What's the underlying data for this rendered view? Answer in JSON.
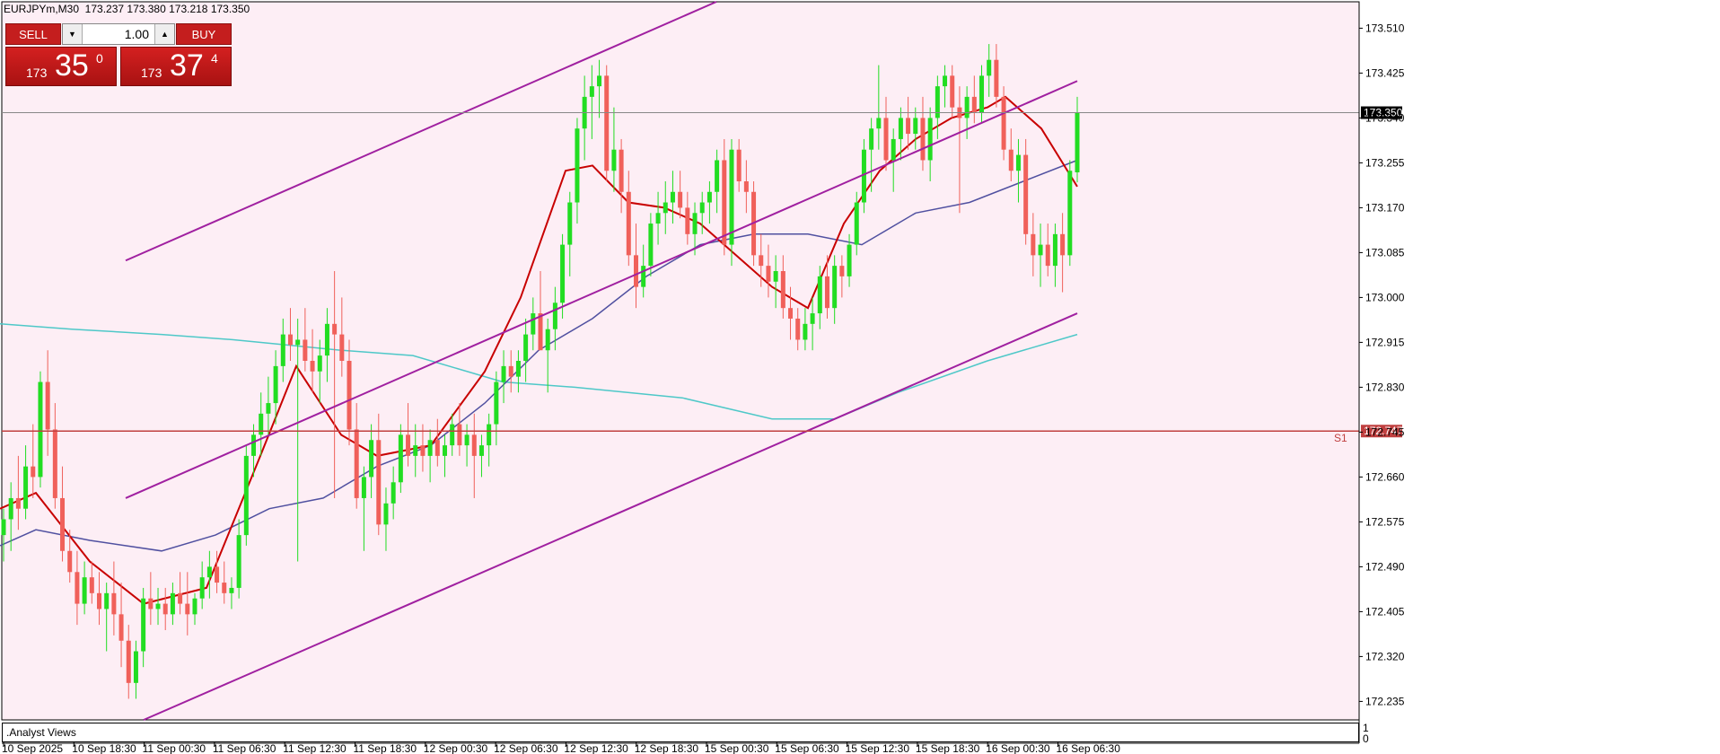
{
  "symbol_info": "EURJPYm,M30  173.237 173.380 173.218 173.350",
  "trade_panel": {
    "sell_label": "SELL",
    "buy_label": "BUY",
    "lot": "1.00",
    "sell_price": {
      "prefix": "173",
      "big": "35",
      "sup": "0"
    },
    "buy_price": {
      "prefix": "173",
      "big": "37",
      "sup": "4"
    }
  },
  "price_axis": {
    "ticks": [
      "173.510",
      "173.425",
      "173.340",
      "173.255",
      "173.170",
      "173.085",
      "173.000",
      "172.915",
      "172.830",
      "172.745",
      "172.660",
      "172.575",
      "172.490",
      "172.405",
      "172.320",
      "172.235"
    ],
    "current_price": "173.350",
    "support_price": "172.747",
    "support_label": "S1"
  },
  "time_axis": {
    "labels": [
      "10 Sep 2025",
      "10 Sep 18:30",
      "11 Sep 00:30",
      "11 Sep 06:30",
      "11 Sep 12:30",
      "11 Sep 18:30",
      "12 Sep 00:30",
      "12 Sep 06:30",
      "12 Sep 12:30",
      "12 Sep 18:30",
      "15 Sep 00:30",
      "15 Sep 06:30",
      "15 Sep 12:30",
      "15 Sep 18:30",
      "16 Sep 00:30",
      "16 Sep 06:30"
    ]
  },
  "indicator_pane": {
    "label": ".Analyst Views",
    "scale_top": "1",
    "scale_bottom": "0"
  },
  "colors": {
    "background": "#fdeef5",
    "bull": "#22dd22",
    "bear": "#f0605a",
    "channel": "#a020a0",
    "ma_fast": "#c80000",
    "ma_mid": "#5050a0",
    "ma_slow": "#4ec8c8",
    "support": "#c04040"
  },
  "chart_data": {
    "type": "candlestick",
    "title": "EURJPYm,M30",
    "ylim": [
      172.2,
      173.56
    ],
    "last": {
      "open": 173.237,
      "high": 173.38,
      "low": 173.218,
      "close": 173.35
    },
    "support_level": 172.747,
    "candles": [
      [
        172.55,
        172.6,
        172.5,
        172.58
      ],
      [
        172.58,
        172.65,
        172.52,
        172.62
      ],
      [
        172.62,
        172.7,
        172.56,
        172.6
      ],
      [
        172.6,
        172.72,
        172.58,
        172.68
      ],
      [
        172.68,
        172.76,
        172.62,
        172.66
      ],
      [
        172.66,
        172.86,
        172.64,
        172.84
      ],
      [
        172.84,
        172.9,
        172.7,
        172.75
      ],
      [
        172.75,
        172.8,
        172.6,
        172.62
      ],
      [
        172.62,
        172.68,
        172.5,
        172.52
      ],
      [
        172.52,
        172.56,
        172.46,
        172.48
      ],
      [
        172.48,
        172.52,
        172.38,
        172.42
      ],
      [
        172.42,
        172.5,
        172.4,
        172.47
      ],
      [
        172.47,
        172.5,
        172.42,
        172.44
      ],
      [
        172.44,
        172.48,
        172.38,
        172.41
      ],
      [
        172.41,
        172.46,
        172.33,
        172.44
      ],
      [
        172.44,
        172.5,
        172.36,
        172.4
      ],
      [
        172.4,
        172.46,
        172.3,
        172.35
      ],
      [
        172.35,
        172.38,
        172.24,
        172.27
      ],
      [
        172.27,
        172.35,
        172.24,
        172.33
      ],
      [
        172.33,
        172.45,
        172.3,
        172.43
      ],
      [
        172.43,
        172.48,
        172.38,
        172.41
      ],
      [
        172.41,
        172.45,
        172.38,
        172.42
      ],
      [
        172.42,
        172.45,
        172.37,
        172.4
      ],
      [
        172.4,
        172.46,
        172.38,
        172.44
      ],
      [
        172.44,
        172.48,
        172.4,
        172.42
      ],
      [
        172.42,
        172.48,
        172.36,
        172.4
      ],
      [
        172.4,
        172.44,
        172.38,
        172.43
      ],
      [
        172.43,
        172.5,
        172.41,
        172.47
      ],
      [
        172.47,
        172.52,
        172.43,
        172.49
      ],
      [
        172.49,
        172.52,
        172.44,
        172.46
      ],
      [
        172.46,
        172.5,
        172.42,
        172.44
      ],
      [
        172.44,
        172.47,
        172.41,
        172.45
      ],
      [
        172.45,
        172.58,
        172.43,
        172.55
      ],
      [
        172.55,
        172.72,
        172.53,
        172.7
      ],
      [
        172.7,
        172.76,
        172.66,
        172.74
      ],
      [
        172.74,
        172.82,
        172.7,
        172.78
      ],
      [
        172.78,
        172.85,
        172.74,
        172.8
      ],
      [
        172.8,
        172.9,
        172.76,
        172.87
      ],
      [
        172.87,
        172.96,
        172.84,
        172.93
      ],
      [
        172.93,
        172.98,
        172.88,
        172.91
      ],
      [
        172.91,
        172.96,
        172.5,
        172.92
      ],
      [
        172.92,
        172.98,
        172.86,
        172.88
      ],
      [
        172.88,
        172.94,
        172.82,
        172.86
      ],
      [
        172.86,
        172.92,
        172.8,
        172.89
      ],
      [
        172.89,
        172.98,
        172.84,
        172.95
      ],
      [
        172.95,
        173.05,
        172.62,
        172.93
      ],
      [
        172.93,
        173.0,
        172.85,
        172.88
      ],
      [
        172.88,
        172.92,
        172.72,
        172.75
      ],
      [
        172.75,
        172.8,
        172.6,
        172.62
      ],
      [
        172.62,
        172.68,
        172.52,
        172.66
      ],
      [
        172.66,
        172.76,
        172.62,
        172.73
      ],
      [
        172.73,
        172.78,
        172.55,
        172.57
      ],
      [
        172.57,
        172.64,
        172.52,
        172.61
      ],
      [
        172.61,
        172.68,
        172.58,
        172.65
      ],
      [
        172.65,
        172.76,
        172.63,
        172.74
      ],
      [
        172.74,
        172.8,
        172.68,
        172.7
      ],
      [
        172.7,
        172.76,
        172.66,
        172.72
      ],
      [
        172.72,
        172.76,
        172.67,
        172.7
      ],
      [
        172.7,
        172.75,
        172.65,
        172.73
      ],
      [
        172.73,
        172.77,
        172.68,
        172.7
      ],
      [
        172.7,
        172.74,
        172.66,
        172.72
      ],
      [
        172.72,
        172.78,
        172.7,
        172.76
      ],
      [
        172.76,
        172.8,
        172.7,
        172.72
      ],
      [
        172.72,
        172.76,
        172.68,
        172.74
      ],
      [
        172.74,
        172.78,
        172.62,
        172.7
      ],
      [
        172.7,
        172.74,
        172.66,
        172.72
      ],
      [
        172.72,
        172.78,
        172.68,
        172.76
      ],
      [
        172.76,
        172.86,
        172.72,
        172.84
      ],
      [
        172.84,
        172.9,
        172.8,
        172.87
      ],
      [
        172.87,
        172.9,
        172.82,
        172.85
      ],
      [
        172.85,
        172.9,
        172.82,
        172.88
      ],
      [
        172.88,
        172.96,
        172.84,
        172.93
      ],
      [
        172.93,
        173.0,
        172.9,
        172.97
      ],
      [
        172.97,
        173.05,
        172.92,
        172.9
      ],
      [
        172.9,
        172.96,
        172.82,
        172.94
      ],
      [
        172.94,
        173.02,
        172.9,
        172.99
      ],
      [
        172.99,
        173.12,
        172.96,
        173.1
      ],
      [
        173.1,
        173.2,
        173.04,
        173.18
      ],
      [
        173.18,
        173.34,
        173.14,
        173.32
      ],
      [
        173.32,
        173.42,
        173.26,
        173.38
      ],
      [
        173.38,
        173.44,
        173.3,
        173.4
      ],
      [
        173.4,
        173.45,
        173.34,
        173.42
      ],
      [
        173.42,
        173.44,
        173.22,
        173.24
      ],
      [
        173.24,
        173.36,
        173.2,
        173.28
      ],
      [
        173.28,
        173.3,
        173.16,
        173.2
      ],
      [
        173.2,
        173.24,
        173.06,
        173.08
      ],
      [
        173.08,
        173.14,
        172.98,
        173.02
      ],
      [
        173.02,
        173.1,
        173.0,
        173.06
      ],
      [
        173.06,
        173.16,
        173.04,
        173.14
      ],
      [
        173.14,
        173.2,
        173.1,
        173.16
      ],
      [
        173.16,
        173.22,
        173.12,
        173.18
      ],
      [
        173.18,
        173.24,
        173.14,
        173.2
      ],
      [
        173.2,
        173.24,
        173.15,
        173.17
      ],
      [
        173.17,
        173.2,
        173.1,
        173.12
      ],
      [
        173.12,
        173.18,
        173.08,
        173.16
      ],
      [
        173.16,
        173.2,
        173.12,
        173.18
      ],
      [
        173.18,
        173.22,
        173.14,
        173.2
      ],
      [
        173.2,
        173.28,
        173.16,
        173.26
      ],
      [
        173.26,
        173.3,
        173.08,
        173.1
      ],
      [
        173.1,
        173.3,
        173.06,
        173.28
      ],
      [
        173.28,
        173.3,
        173.2,
        173.22
      ],
      [
        173.22,
        173.26,
        173.16,
        173.2
      ],
      [
        173.2,
        173.22,
        173.06,
        173.08
      ],
      [
        173.08,
        173.12,
        173.02,
        173.06
      ],
      [
        173.06,
        173.1,
        173.0,
        173.03
      ],
      [
        173.03,
        173.08,
        172.98,
        173.05
      ],
      [
        173.05,
        173.08,
        172.96,
        172.98
      ],
      [
        172.98,
        173.02,
        172.92,
        172.96
      ],
      [
        172.96,
        172.98,
        172.9,
        172.92
      ],
      [
        172.92,
        172.98,
        172.9,
        172.95
      ],
      [
        172.95,
        173.0,
        172.9,
        172.97
      ],
      [
        172.97,
        173.06,
        172.94,
        173.04
      ],
      [
        173.04,
        173.08,
        172.96,
        172.98
      ],
      [
        172.98,
        173.08,
        172.95,
        173.06
      ],
      [
        173.06,
        173.08,
        173.0,
        173.04
      ],
      [
        173.04,
        173.12,
        173.02,
        173.1
      ],
      [
        173.1,
        173.2,
        173.08,
        173.18
      ],
      [
        173.18,
        173.3,
        173.16,
        173.28
      ],
      [
        173.28,
        173.34,
        173.2,
        173.32
      ],
      [
        173.32,
        173.44,
        173.28,
        173.34
      ],
      [
        173.34,
        173.38,
        173.24,
        173.26
      ],
      [
        173.26,
        173.32,
        173.2,
        173.3
      ],
      [
        173.3,
        173.36,
        173.26,
        173.34
      ],
      [
        173.34,
        173.38,
        173.28,
        173.31
      ],
      [
        173.31,
        173.36,
        173.28,
        173.34
      ],
      [
        173.34,
        173.38,
        173.24,
        173.26
      ],
      [
        173.26,
        173.36,
        173.22,
        173.34
      ],
      [
        173.34,
        173.42,
        173.3,
        173.4
      ],
      [
        173.4,
        173.44,
        173.36,
        173.42
      ],
      [
        173.42,
        173.44,
        173.34,
        173.36
      ],
      [
        173.36,
        173.4,
        173.16,
        173.34
      ],
      [
        173.34,
        173.4,
        173.3,
        173.38
      ],
      [
        173.38,
        173.42,
        173.33,
        173.35
      ],
      [
        173.35,
        173.44,
        173.33,
        173.42
      ],
      [
        173.42,
        173.48,
        173.38,
        173.45
      ],
      [
        173.45,
        173.48,
        173.36,
        173.38
      ],
      [
        173.38,
        173.4,
        173.26,
        173.28
      ],
      [
        173.28,
        173.32,
        173.22,
        173.24
      ],
      [
        173.24,
        173.3,
        173.18,
        173.27
      ],
      [
        173.27,
        173.3,
        173.1,
        173.12
      ],
      [
        173.12,
        173.16,
        173.04,
        173.08
      ],
      [
        173.08,
        173.14,
        173.02,
        173.1
      ],
      [
        173.1,
        173.14,
        173.04,
        173.06
      ],
      [
        173.06,
        173.14,
        173.02,
        173.12
      ],
      [
        173.12,
        173.16,
        173.01,
        173.08
      ],
      [
        173.08,
        173.26,
        173.06,
        173.24
      ],
      [
        173.237,
        173.38,
        173.218,
        173.35
      ]
    ],
    "ma_fast": [
      [
        0,
        172.6
      ],
      [
        40,
        172.63
      ],
      [
        100,
        172.5
      ],
      [
        160,
        172.42
      ],
      [
        230,
        172.45
      ],
      [
        290,
        172.7
      ],
      [
        330,
        172.87
      ],
      [
        380,
        172.74
      ],
      [
        420,
        172.7
      ],
      [
        480,
        172.72
      ],
      [
        540,
        172.86
      ],
      [
        580,
        173.0
      ],
      [
        630,
        173.24
      ],
      [
        660,
        173.25
      ],
      [
        700,
        173.18
      ],
      [
        740,
        173.17
      ],
      [
        780,
        173.14
      ],
      [
        820,
        173.08
      ],
      [
        860,
        173.02
      ],
      [
        900,
        172.98
      ],
      [
        940,
        173.14
      ],
      [
        980,
        173.24
      ],
      [
        1020,
        173.3
      ],
      [
        1060,
        173.34
      ],
      [
        1100,
        173.36
      ],
      [
        1120,
        173.38
      ],
      [
        1160,
        173.32
      ],
      [
        1200,
        173.21
      ]
    ],
    "ma_mid": [
      [
        0,
        172.53
      ],
      [
        40,
        172.56
      ],
      [
        100,
        172.54
      ],
      [
        180,
        172.52
      ],
      [
        240,
        172.55
      ],
      [
        300,
        172.6
      ],
      [
        360,
        172.62
      ],
      [
        420,
        172.68
      ],
      [
        480,
        172.72
      ],
      [
        540,
        172.8
      ],
      [
        600,
        172.9
      ],
      [
        660,
        172.96
      ],
      [
        720,
        173.04
      ],
      [
        780,
        173.1
      ],
      [
        840,
        173.12
      ],
      [
        900,
        173.12
      ],
      [
        960,
        173.1
      ],
      [
        1020,
        173.16
      ],
      [
        1080,
        173.18
      ],
      [
        1140,
        173.22
      ],
      [
        1200,
        173.26
      ]
    ],
    "ma_slow": [
      [
        0,
        172.95
      ],
      [
        80,
        172.94
      ],
      [
        180,
        172.93
      ],
      [
        260,
        172.92
      ],
      [
        380,
        172.9
      ],
      [
        460,
        172.89
      ],
      [
        560,
        172.84
      ],
      [
        640,
        172.83
      ],
      [
        760,
        172.81
      ],
      [
        860,
        172.77
      ],
      [
        930,
        172.77
      ],
      [
        1000,
        172.82
      ],
      [
        1100,
        172.88
      ],
      [
        1200,
        172.93
      ]
    ],
    "channel_lines": [
      {
        "from": [
          140,
          173.07
        ],
        "to": [
          798,
          173.56
        ]
      },
      {
        "from": [
          140,
          172.62
        ],
        "to": [
          1200,
          173.41
        ]
      },
      {
        "from": [
          160,
          172.2
        ],
        "to": [
          1200,
          172.97
        ]
      }
    ]
  }
}
